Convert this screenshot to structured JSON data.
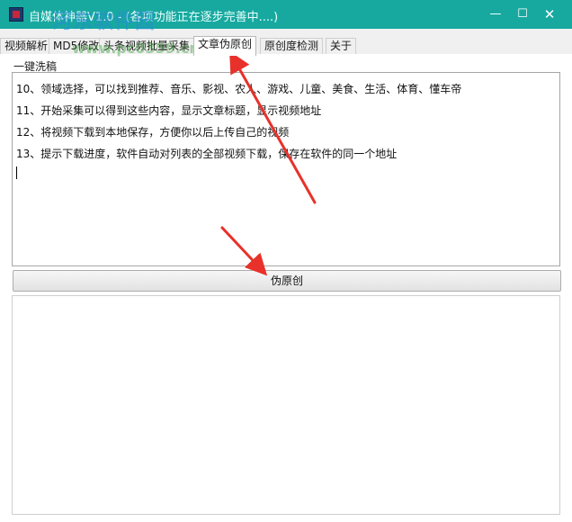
{
  "window": {
    "title": "自媒体神器V1.0 - (各项功能正在逐步完善中....)",
    "minimize_glyph": "—",
    "maximize_glyph": "☐",
    "close_glyph": "✕",
    "icon": "app-icon"
  },
  "tabs": [
    {
      "label": "视频解析"
    },
    {
      "label": "MD5修改"
    },
    {
      "label": "头条视频批量采集"
    },
    {
      "label": "文章伪原创",
      "active": true
    },
    {
      "label": "原创度检测"
    },
    {
      "label": "关于"
    }
  ],
  "panel": {
    "section_label": "一键洗稿",
    "lines": [
      "10、领域选择，可以找到推荐、音乐、影视、农人、游戏、儿童、美食、生活、体育、懂车帝",
      "11、开始采集可以得到这些内容，显示文章标题，显示视频地址",
      "12、将视频下载到本地保存，方便你以后上传自己的视频",
      "13、提示下载进度，软件自动对列表的全部视频下载，保存在软件的同一个地址"
    ],
    "action_button": "伪原创"
  },
  "watermark": {
    "main": "河东软件园",
    "url": "www.pc0359.cn"
  },
  "colors": {
    "titlebar": "#17a9a0",
    "annotation_arrow": "#e8312a"
  }
}
